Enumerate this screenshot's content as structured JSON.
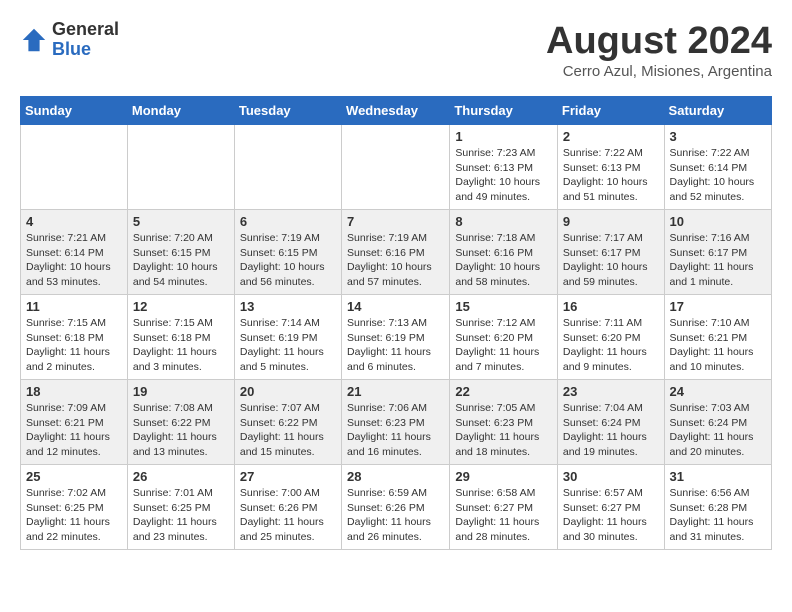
{
  "logo": {
    "general": "General",
    "blue": "Blue"
  },
  "title": "August 2024",
  "subtitle": "Cerro Azul, Misiones, Argentina",
  "days_header": [
    "Sunday",
    "Monday",
    "Tuesday",
    "Wednesday",
    "Thursday",
    "Friday",
    "Saturday"
  ],
  "weeks": [
    [
      {
        "day": "",
        "info": ""
      },
      {
        "day": "",
        "info": ""
      },
      {
        "day": "",
        "info": ""
      },
      {
        "day": "",
        "info": ""
      },
      {
        "day": "1",
        "info": "Sunrise: 7:23 AM\nSunset: 6:13 PM\nDaylight: 10 hours\nand 49 minutes."
      },
      {
        "day": "2",
        "info": "Sunrise: 7:22 AM\nSunset: 6:13 PM\nDaylight: 10 hours\nand 51 minutes."
      },
      {
        "day": "3",
        "info": "Sunrise: 7:22 AM\nSunset: 6:14 PM\nDaylight: 10 hours\nand 52 minutes."
      }
    ],
    [
      {
        "day": "4",
        "info": "Sunrise: 7:21 AM\nSunset: 6:14 PM\nDaylight: 10 hours\nand 53 minutes."
      },
      {
        "day": "5",
        "info": "Sunrise: 7:20 AM\nSunset: 6:15 PM\nDaylight: 10 hours\nand 54 minutes."
      },
      {
        "day": "6",
        "info": "Sunrise: 7:19 AM\nSunset: 6:15 PM\nDaylight: 10 hours\nand 56 minutes."
      },
      {
        "day": "7",
        "info": "Sunrise: 7:19 AM\nSunset: 6:16 PM\nDaylight: 10 hours\nand 57 minutes."
      },
      {
        "day": "8",
        "info": "Sunrise: 7:18 AM\nSunset: 6:16 PM\nDaylight: 10 hours\nand 58 minutes."
      },
      {
        "day": "9",
        "info": "Sunrise: 7:17 AM\nSunset: 6:17 PM\nDaylight: 10 hours\nand 59 minutes."
      },
      {
        "day": "10",
        "info": "Sunrise: 7:16 AM\nSunset: 6:17 PM\nDaylight: 11 hours\nand 1 minute."
      }
    ],
    [
      {
        "day": "11",
        "info": "Sunrise: 7:15 AM\nSunset: 6:18 PM\nDaylight: 11 hours\nand 2 minutes."
      },
      {
        "day": "12",
        "info": "Sunrise: 7:15 AM\nSunset: 6:18 PM\nDaylight: 11 hours\nand 3 minutes."
      },
      {
        "day": "13",
        "info": "Sunrise: 7:14 AM\nSunset: 6:19 PM\nDaylight: 11 hours\nand 5 minutes."
      },
      {
        "day": "14",
        "info": "Sunrise: 7:13 AM\nSunset: 6:19 PM\nDaylight: 11 hours\nand 6 minutes."
      },
      {
        "day": "15",
        "info": "Sunrise: 7:12 AM\nSunset: 6:20 PM\nDaylight: 11 hours\nand 7 minutes."
      },
      {
        "day": "16",
        "info": "Sunrise: 7:11 AM\nSunset: 6:20 PM\nDaylight: 11 hours\nand 9 minutes."
      },
      {
        "day": "17",
        "info": "Sunrise: 7:10 AM\nSunset: 6:21 PM\nDaylight: 11 hours\nand 10 minutes."
      }
    ],
    [
      {
        "day": "18",
        "info": "Sunrise: 7:09 AM\nSunset: 6:21 PM\nDaylight: 11 hours\nand 12 minutes."
      },
      {
        "day": "19",
        "info": "Sunrise: 7:08 AM\nSunset: 6:22 PM\nDaylight: 11 hours\nand 13 minutes."
      },
      {
        "day": "20",
        "info": "Sunrise: 7:07 AM\nSunset: 6:22 PM\nDaylight: 11 hours\nand 15 minutes."
      },
      {
        "day": "21",
        "info": "Sunrise: 7:06 AM\nSunset: 6:23 PM\nDaylight: 11 hours\nand 16 minutes."
      },
      {
        "day": "22",
        "info": "Sunrise: 7:05 AM\nSunset: 6:23 PM\nDaylight: 11 hours\nand 18 minutes."
      },
      {
        "day": "23",
        "info": "Sunrise: 7:04 AM\nSunset: 6:24 PM\nDaylight: 11 hours\nand 19 minutes."
      },
      {
        "day": "24",
        "info": "Sunrise: 7:03 AM\nSunset: 6:24 PM\nDaylight: 11 hours\nand 20 minutes."
      }
    ],
    [
      {
        "day": "25",
        "info": "Sunrise: 7:02 AM\nSunset: 6:25 PM\nDaylight: 11 hours\nand 22 minutes."
      },
      {
        "day": "26",
        "info": "Sunrise: 7:01 AM\nSunset: 6:25 PM\nDaylight: 11 hours\nand 23 minutes."
      },
      {
        "day": "27",
        "info": "Sunrise: 7:00 AM\nSunset: 6:26 PM\nDaylight: 11 hours\nand 25 minutes."
      },
      {
        "day": "28",
        "info": "Sunrise: 6:59 AM\nSunset: 6:26 PM\nDaylight: 11 hours\nand 26 minutes."
      },
      {
        "day": "29",
        "info": "Sunrise: 6:58 AM\nSunset: 6:27 PM\nDaylight: 11 hours\nand 28 minutes."
      },
      {
        "day": "30",
        "info": "Sunrise: 6:57 AM\nSunset: 6:27 PM\nDaylight: 11 hours\nand 30 minutes."
      },
      {
        "day": "31",
        "info": "Sunrise: 6:56 AM\nSunset: 6:28 PM\nDaylight: 11 hours\nand 31 minutes."
      }
    ]
  ]
}
